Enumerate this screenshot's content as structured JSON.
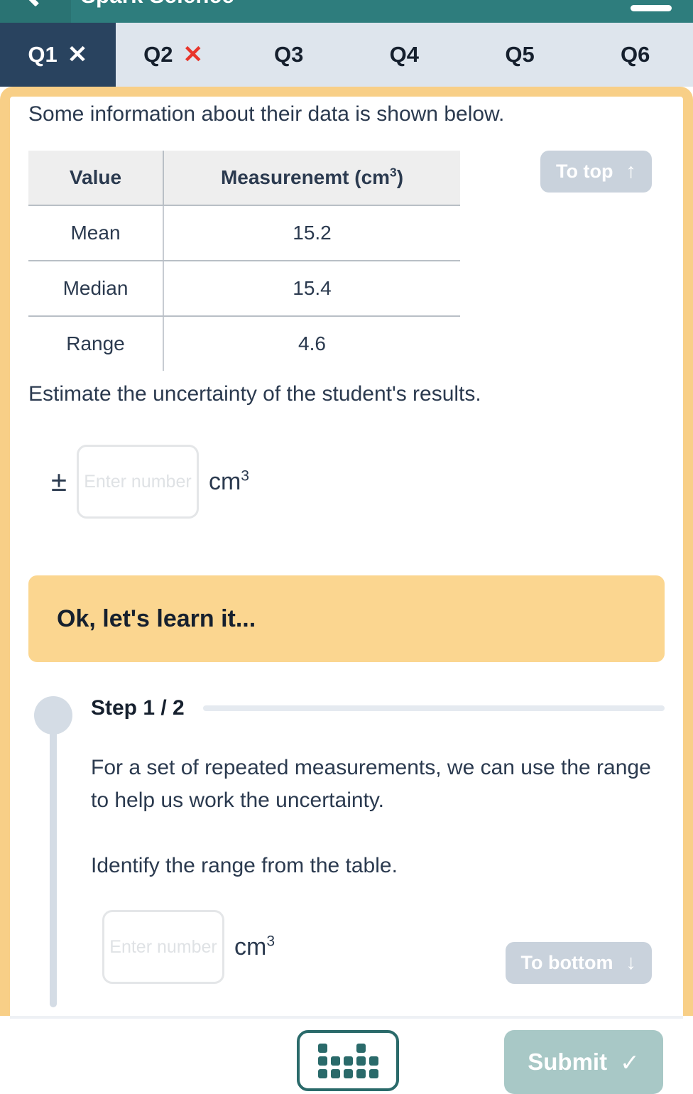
{
  "header": {
    "title": "Spark Science",
    "back_icon": "back-chevron-icon",
    "menu_icon": "hamburger-menu-icon"
  },
  "tabs": [
    {
      "label": "Q1",
      "mark": "✕",
      "mark_style": "white",
      "active": true
    },
    {
      "label": "Q2",
      "mark": "✕",
      "mark_style": "red",
      "active": false
    },
    {
      "label": "Q3",
      "mark": "",
      "mark_style": "none",
      "active": false
    },
    {
      "label": "Q4",
      "mark": "",
      "mark_style": "none",
      "active": false
    },
    {
      "label": "Q5",
      "mark": "",
      "mark_style": "none",
      "active": false
    },
    {
      "label": "Q6",
      "mark": "",
      "mark_style": "none",
      "active": false
    }
  ],
  "question": {
    "intro": "Some information about their data is shown below.",
    "prompt": "Estimate the uncertainty of the student's results.",
    "plusminus": "±",
    "unit_base": "cm",
    "unit_exponent": "3",
    "input_placeholder": "Enter number",
    "input_value": ""
  },
  "table": {
    "headers": {
      "col1": "Value",
      "col2_text": "Measurenemt (cm",
      "col2_exponent": "3",
      "col2_close": ")"
    },
    "rows": [
      {
        "label": "Mean",
        "value": "15.2"
      },
      {
        "label": "Median",
        "value": "15.4"
      },
      {
        "label": "Range",
        "value": "4.6"
      }
    ]
  },
  "scroll_buttons": {
    "to_top": {
      "label": "To top",
      "arrow": "↑"
    },
    "to_bottom": {
      "label": "To bottom",
      "arrow": "↓"
    }
  },
  "learn_banner": {
    "label": "Ok, let's learn it..."
  },
  "step": {
    "label": "Step 1 / 2",
    "paragraph_1": "For a set of repeated measurements, we can use the range to help us work the uncertainty.",
    "paragraph_2": "Identify the range from the table.",
    "input_placeholder": "Enter number",
    "input_value": "",
    "unit_base": "cm",
    "unit_exponent": "3"
  },
  "bottom_bar": {
    "calculator_icon": "calculator-keypad-icon",
    "submit_label": "Submit",
    "submit_check": "✓"
  },
  "colors": {
    "header_teal": "#2e7d7d",
    "tab_active": "#29435f",
    "tab_strip": "#dee5ed",
    "amber_border": "#f8cf87",
    "banner_amber": "#fbd690",
    "mark_red": "#e8352b",
    "pill_gray": "#c9d2dc",
    "submit_teal": "#a8c8c6",
    "text_navy": "#2b3a4f"
  }
}
